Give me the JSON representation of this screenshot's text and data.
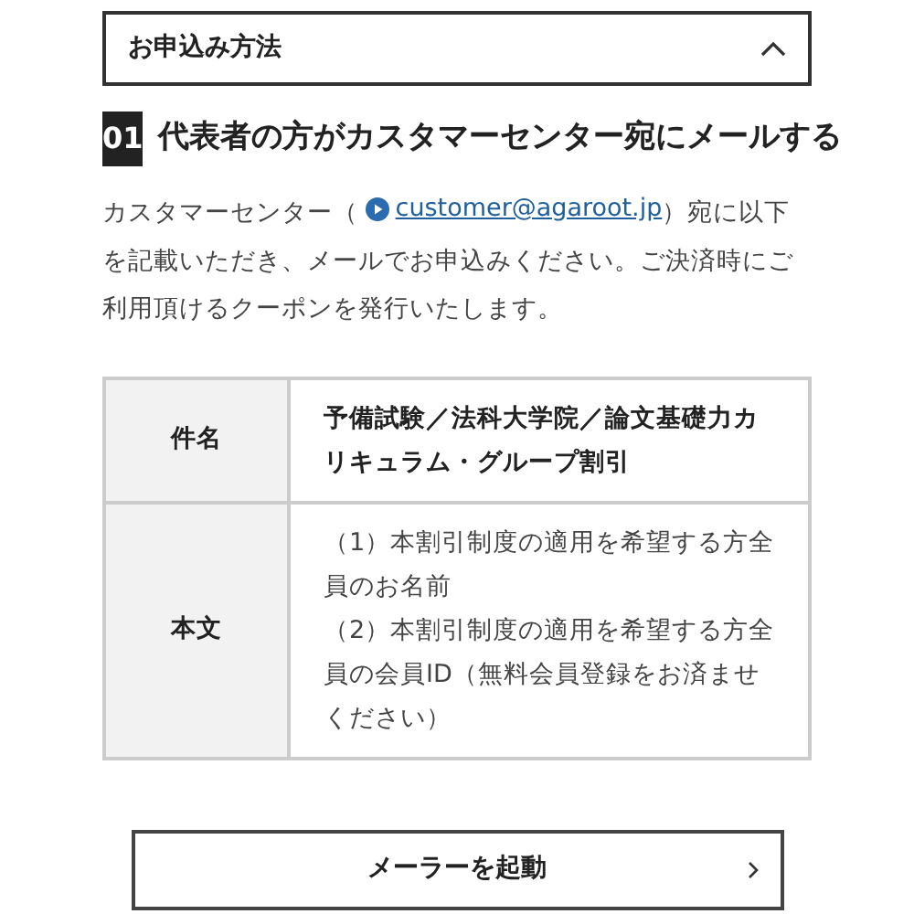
{
  "accordion": {
    "title": "お申込み方法",
    "expanded": true
  },
  "step": {
    "number": "01",
    "title": "代表者の方がカスタマーセンター宛にメールする"
  },
  "intro": {
    "before": "カスタマーセンター（ ",
    "link": "customer@agaroot.jp",
    "after": "）宛に以下を記載いただき、メールでお申込みください。ご決済時にご利用頂けるクーポンを発行いたします。"
  },
  "table": {
    "rows": [
      {
        "label": "件名",
        "kind": "bold",
        "lines": [
          "予備試験／法科大学院／論文基礎力カリキュラム・グループ割引"
        ]
      },
      {
        "label": "本文",
        "kind": "plain",
        "lines": [
          "（1）本割引制度の適用を希望する方全員のお名前",
          "（2）本割引制度の適用を希望する方全員の会員ID（無料会員登録をお済ませください）"
        ]
      }
    ]
  },
  "button": {
    "label": "メーラーを起動"
  }
}
